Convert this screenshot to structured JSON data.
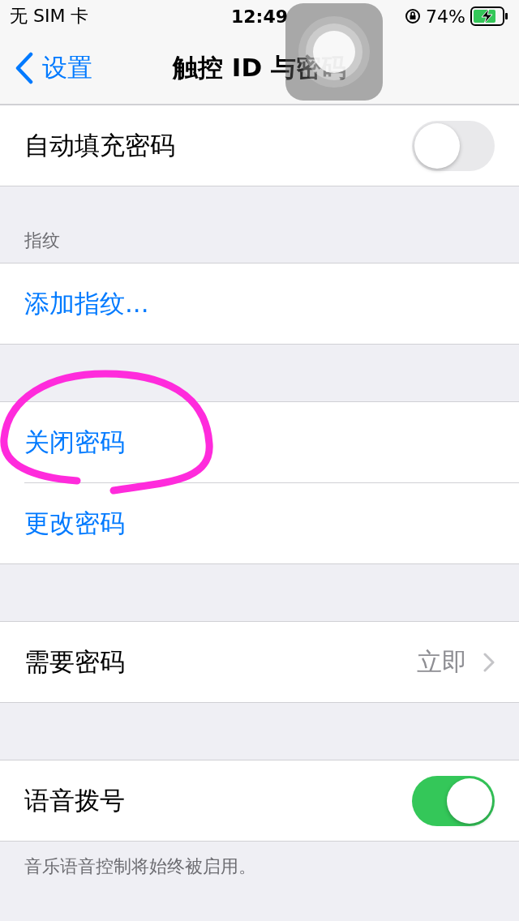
{
  "status_bar": {
    "carrier": "无 SIM 卡",
    "time": "12:49",
    "battery": "74%"
  },
  "nav": {
    "back": "设置",
    "title": "触控 ID 与密码"
  },
  "sections": [
    {
      "rows": [
        {
          "kind": "toggle",
          "label": "自动填充密码",
          "on": false
        }
      ]
    },
    {
      "header": "指纹",
      "rows": [
        {
          "kind": "link",
          "label": "添加指纹..."
        }
      ]
    },
    {
      "rows": [
        {
          "kind": "link",
          "label": "关闭密码"
        },
        {
          "kind": "link",
          "label": "更改密码"
        }
      ]
    },
    {
      "rows": [
        {
          "kind": "detail",
          "label": "需要密码",
          "value": "立即"
        }
      ]
    },
    {
      "rows": [
        {
          "kind": "toggle",
          "label": "语音拨号",
          "on": true
        }
      ],
      "footer": "音乐语音控制将始终被启用。"
    }
  ]
}
